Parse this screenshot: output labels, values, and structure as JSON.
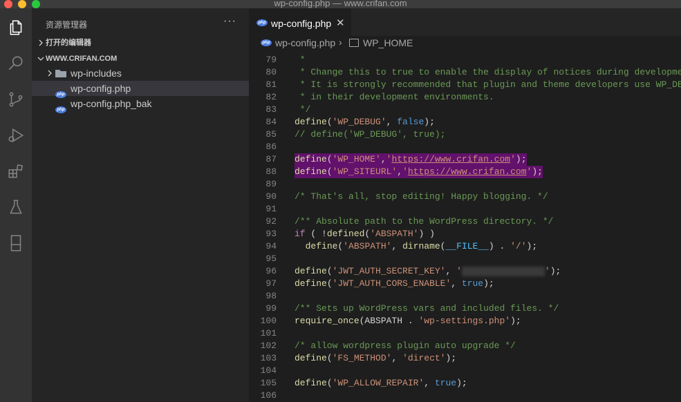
{
  "window": {
    "title": "wp-config.php — www.crifan.com"
  },
  "explorer": {
    "title": "资源管理器",
    "more": "···",
    "open_editors": "打开的编辑器",
    "folder": "WWW.CRIFAN.COM",
    "items": [
      {
        "name": "wp-includes",
        "type": "folder"
      },
      {
        "name": "wp-config.php",
        "type": "php"
      },
      {
        "name": "wp-config.php_bak",
        "type": "php"
      }
    ]
  },
  "tab": {
    "label": "wp-config.php",
    "close": "✕",
    "badge": "php"
  },
  "breadcrumb": {
    "file": "wp-config.php",
    "sep": "›",
    "symbol": "WP_HOME"
  },
  "editor": {
    "lines": [
      {
        "n": "79",
        "t": " *"
      },
      {
        "n": "80",
        "t": " * Change this to true to enable the display of notices during development."
      },
      {
        "n": "81",
        "t": " * It is strongly recommended that plugin and theme developers use WP_DEBUG"
      },
      {
        "n": "82",
        "t": " * in their development environments."
      },
      {
        "n": "83",
        "t": " */"
      },
      {
        "n": "84",
        "t": "define('WP_DEBUG', false);"
      },
      {
        "n": "85",
        "t": "// define('WP_DEBUG', true);"
      },
      {
        "n": "86",
        "t": ""
      },
      {
        "n": "87",
        "t": "define('WP_HOME','https://www.crifan.com');"
      },
      {
        "n": "88",
        "t": "define('WP_SITEURL','https://www.crifan.com');"
      },
      {
        "n": "89",
        "t": ""
      },
      {
        "n": "90",
        "t": "/* That's all, stop editing! Happy blogging. */"
      },
      {
        "n": "91",
        "t": ""
      },
      {
        "n": "92",
        "t": "/** Absolute path to the WordPress directory. */"
      },
      {
        "n": "93",
        "t": "if ( !defined('ABSPATH') )"
      },
      {
        "n": "94",
        "t": "  define('ABSPATH', dirname(__FILE__) . '/');"
      },
      {
        "n": "95",
        "t": ""
      },
      {
        "n": "96",
        "t": "define('JWT_AUTH_SECRET_KEY', '');"
      },
      {
        "n": "97",
        "t": "define('JWT_AUTH_CORS_ENABLE', true);"
      },
      {
        "n": "98",
        "t": ""
      },
      {
        "n": "99",
        "t": "/** Sets up WordPress vars and included files. */"
      },
      {
        "n": "100",
        "t": "require_once(ABSPATH . 'wp-settings.php');"
      },
      {
        "n": "101",
        "t": ""
      },
      {
        "n": "102",
        "t": "/* allow wordpress plugin auto upgrade */"
      },
      {
        "n": "103",
        "t": "define('FS_METHOD', 'direct');"
      },
      {
        "n": "104",
        "t": ""
      },
      {
        "n": "105",
        "t": "define('WP_ALLOW_REPAIR', true);"
      },
      {
        "n": "106",
        "t": ""
      }
    ]
  },
  "colors": {
    "comment": "#6a9955",
    "function": "#dcdcaa",
    "string": "#ce9178",
    "keyword": "#569cd6",
    "control": "#c586c0",
    "highlight": "#62116c"
  },
  "icons": {
    "activity": [
      "files-icon",
      "search-icon",
      "source-control-icon",
      "run-debug-icon",
      "extensions-icon",
      "testing-icon",
      "remote-explorer-icon"
    ]
  }
}
